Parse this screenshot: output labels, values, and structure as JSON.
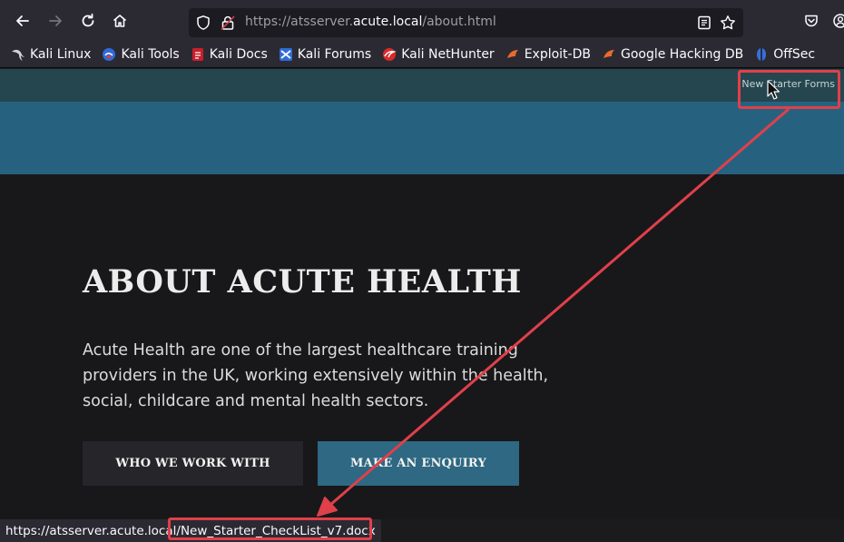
{
  "browser": {
    "url_prefix": "https://atsserver.",
    "url_host": "acute.local",
    "url_path": "/about.html"
  },
  "bookmarks": [
    {
      "label": "Kali Linux",
      "icon": "kali-dragon-icon"
    },
    {
      "label": "Kali Tools",
      "icon": "kali-tools-icon"
    },
    {
      "label": "Kali Docs",
      "icon": "kali-docs-icon"
    },
    {
      "label": "Kali Forums",
      "icon": "kali-forums-icon"
    },
    {
      "label": "Kali NetHunter",
      "icon": "kali-nethunter-icon"
    },
    {
      "label": "Exploit-DB",
      "icon": "exploit-db-icon"
    },
    {
      "label": "Google Hacking DB",
      "icon": "ghdb-icon"
    },
    {
      "label": "OffSec",
      "icon": "offsec-icon"
    }
  ],
  "page": {
    "nav_link": "New Starter Forms",
    "title": "ABOUT ACUTE HEALTH",
    "body": "Acute Health are one of the largest healthcare training providers in the UK, working extensively within the health, social, childcare and mental health sectors.",
    "btn_work": "WHO WE WORK WITH",
    "btn_enquiry": "MAKE AN ENQUIRY"
  },
  "status": {
    "link_prefix": "https://atsserver.acute.local/",
    "link_file": "New_Starter_CheckList_v7.docx"
  },
  "colors": {
    "annotation": "#e0404a",
    "nav_bar": "#25464e",
    "banner": "#266280",
    "page_bg": "#18181b",
    "enquiry_button": "#2e6882"
  }
}
